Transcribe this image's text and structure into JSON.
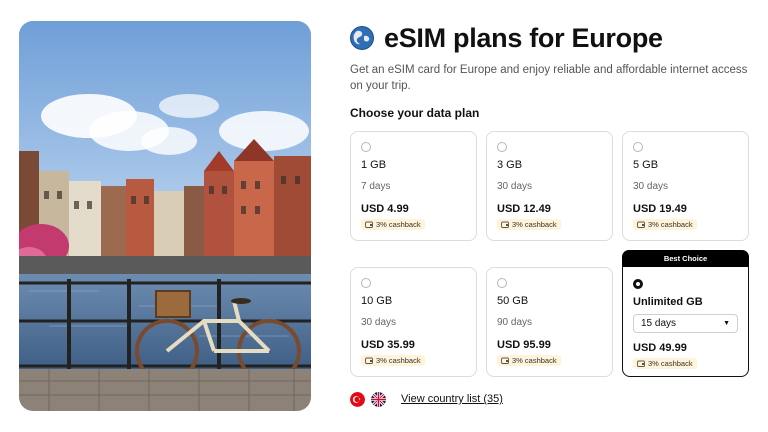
{
  "header": {
    "title": "eSIM plans for Europe",
    "subtitle": "Get an eSIM card for Europe and enjoy reliable and affordable internet access on your trip.",
    "globe_icon": "globe-europe-icon"
  },
  "plans_section": {
    "label": "Choose your data plan",
    "plans": [
      {
        "name": "1 GB",
        "duration": "7 days",
        "price": "USD 4.99",
        "cashback": "3% cashback",
        "selected": false
      },
      {
        "name": "3 GB",
        "duration": "30 days",
        "price": "USD 12.49",
        "cashback": "3% cashback",
        "selected": false
      },
      {
        "name": "5 GB",
        "duration": "30 days",
        "price": "USD 19.49",
        "cashback": "3% cashback",
        "selected": false
      },
      {
        "name": "10 GB",
        "duration": "30 days",
        "price": "USD 35.99",
        "cashback": "3% cashback",
        "selected": false
      },
      {
        "name": "50 GB",
        "duration": "90 days",
        "price": "USD 95.99",
        "cashback": "3% cashback",
        "selected": false
      },
      {
        "name": "Unlimited GB",
        "duration_select": "15 days",
        "price": "USD 49.99",
        "cashback": "3% cashback",
        "selected": true,
        "badge": "Best Choice"
      }
    ]
  },
  "footer": {
    "flags": [
      "turkey-flag-icon",
      "uk-flag-icon"
    ],
    "country_link": "View country list (35)"
  },
  "colors": {
    "text": "#111111",
    "muted": "#666666",
    "card_border": "#dcdcdc",
    "cashback_bg": "#fff4d9",
    "badge_bg": "#000000"
  }
}
